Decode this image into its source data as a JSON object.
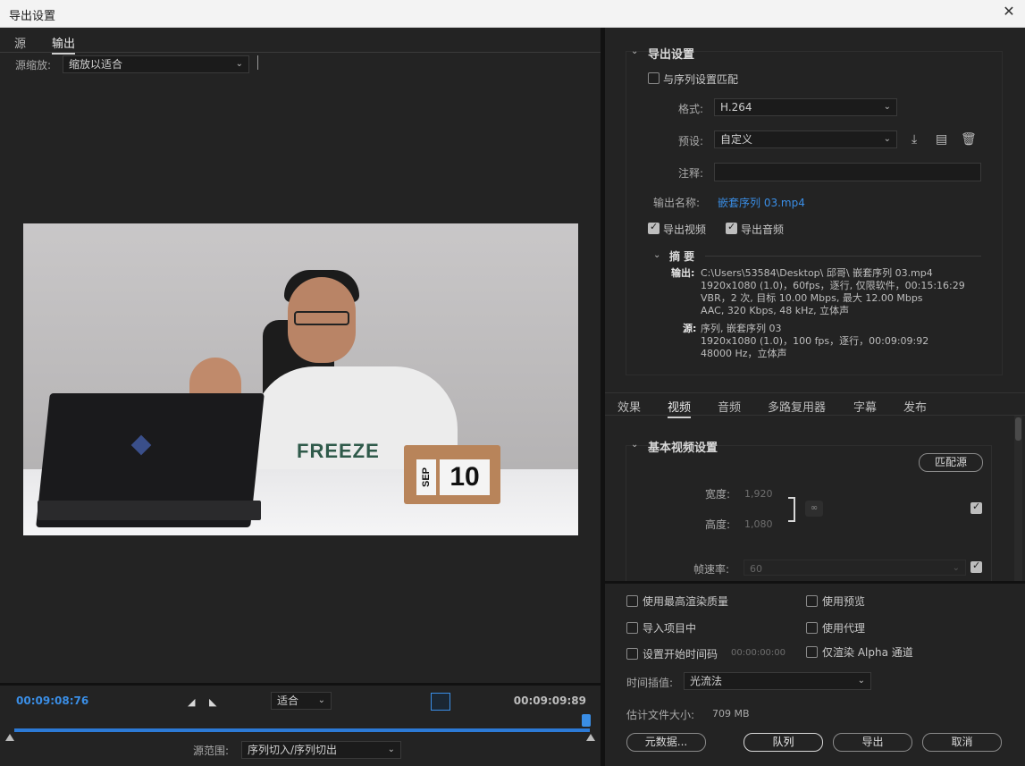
{
  "window": {
    "title": "导出设置",
    "close_icon": "close-icon"
  },
  "left_tabs": {
    "source": "源",
    "output": "输出"
  },
  "source_zoom": {
    "label": "源缩放:",
    "value": "缩放以适合"
  },
  "preview": {
    "shirt_text": "FREEZE",
    "calendar_month": "SEP",
    "calendar_day": "10"
  },
  "transport": {
    "current_tc": "00:09:08:76",
    "fit": "适合",
    "end_tc": "00:09:09:89",
    "source_range_label": "源范围:",
    "source_range_value": "序列切入/序列切出"
  },
  "export_settings": {
    "header": "导出设置",
    "match_sequence": "与序列设置匹配",
    "format_label": "格式:",
    "format_value": "H.264",
    "preset_label": "预设:",
    "preset_value": "自定义",
    "comment_label": "注释:",
    "comment_value": "",
    "output_name_label": "输出名称:",
    "output_name_value": "嵌套序列 03.mp4",
    "export_video": "导出视频",
    "export_audio": "导出音频",
    "summary_header": "摘 要",
    "summary_output_label": "输出:",
    "summary_output_lines": [
      "C:\\Users\\53584\\Desktop\\ 邱哥\\ 嵌套序列 03.mp4",
      "1920x1080 (1.0)，60fps，逐行, 仅限软件，00:15:16:29",
      "VBR，2 次, 目标 10.00 Mbps, 最大 12.00 Mbps",
      "AAC, 320 Kbps, 48  kHz, 立体声"
    ],
    "summary_source_label": "源:",
    "summary_source_lines": [
      "序列, 嵌套序列 03",
      "1920x1080  (1.0)，100 fps，逐行，00:09:09:92",
      "48000 Hz，立体声"
    ]
  },
  "right_tabs": [
    "效果",
    "视频",
    "音频",
    "多路复用器",
    "字幕",
    "发布"
  ],
  "video": {
    "header": "基本视频设置",
    "match_source": "匹配源",
    "width_label": "宽度:",
    "width_value": "1,920",
    "height_label": "高度:",
    "height_value": "1,080",
    "frame_rate_label": "帧速率:",
    "frame_rate_value": "60"
  },
  "options": {
    "max_render_quality": "使用最高渲染质量",
    "use_previews": "使用预览",
    "import_into_project": "导入项目中",
    "use_proxies": "使用代理",
    "set_start_timecode": "设置开始时间码",
    "start_timecode_value": "00:00:00:00",
    "render_alpha_only": "仅渲染 Alpha 通道",
    "time_interp_label": "时间插值:",
    "time_interp_value": "光流法",
    "est_size_label": "估计文件大小:",
    "est_size_value": "709 MB"
  },
  "buttons": {
    "metadata": "元数据...",
    "queue": "队列",
    "export": "导出",
    "cancel": "取消"
  },
  "colors": {
    "accent": "#3a8ee6",
    "bg": "#232323"
  }
}
